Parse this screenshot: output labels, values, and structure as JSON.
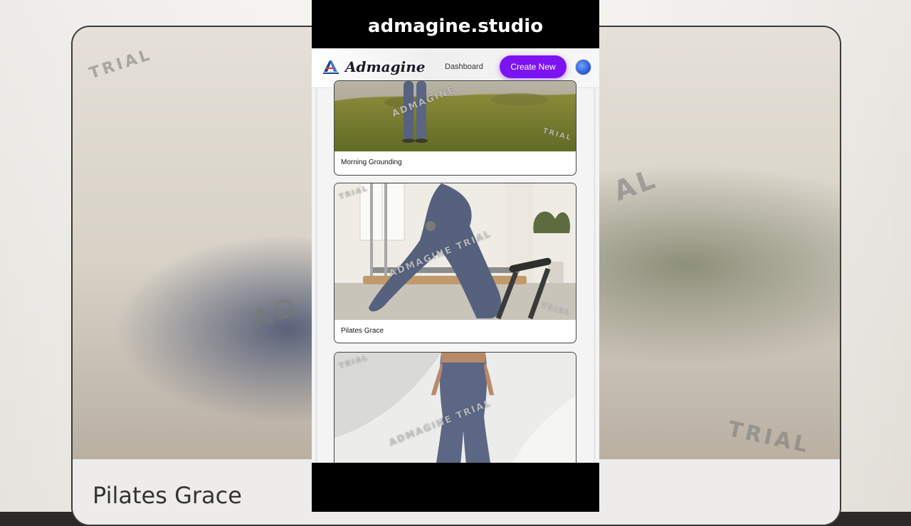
{
  "overlay_title": "admagine.studio",
  "header": {
    "brand": "Admagine",
    "nav_dashboard": "Dashboard",
    "create_button": "Create New"
  },
  "background": {
    "title": "Pilates Grace",
    "watermark_a": "TRIAL",
    "watermark_b": "AD",
    "watermark_c": "TRIAL",
    "watermark_d": "AL"
  },
  "cards": [
    {
      "label": "Morning Grounding",
      "watermark": "ADMAGINE",
      "watermark_corner": "TRIAL"
    },
    {
      "label": "Pilates Grace",
      "watermark": "ADMAGINE TRIAL",
      "watermark_corner": "TRIAL",
      "watermark_corner2": "TRIAL"
    },
    {
      "label": "",
      "watermark": "ADMAGINE TRIAL",
      "watermark_corner": "TRIAL"
    }
  ],
  "icons": {
    "logo": "admagine-logo-icon",
    "avatar": "user-avatar-icon"
  },
  "colors": {
    "accent": "#7b14f0"
  }
}
